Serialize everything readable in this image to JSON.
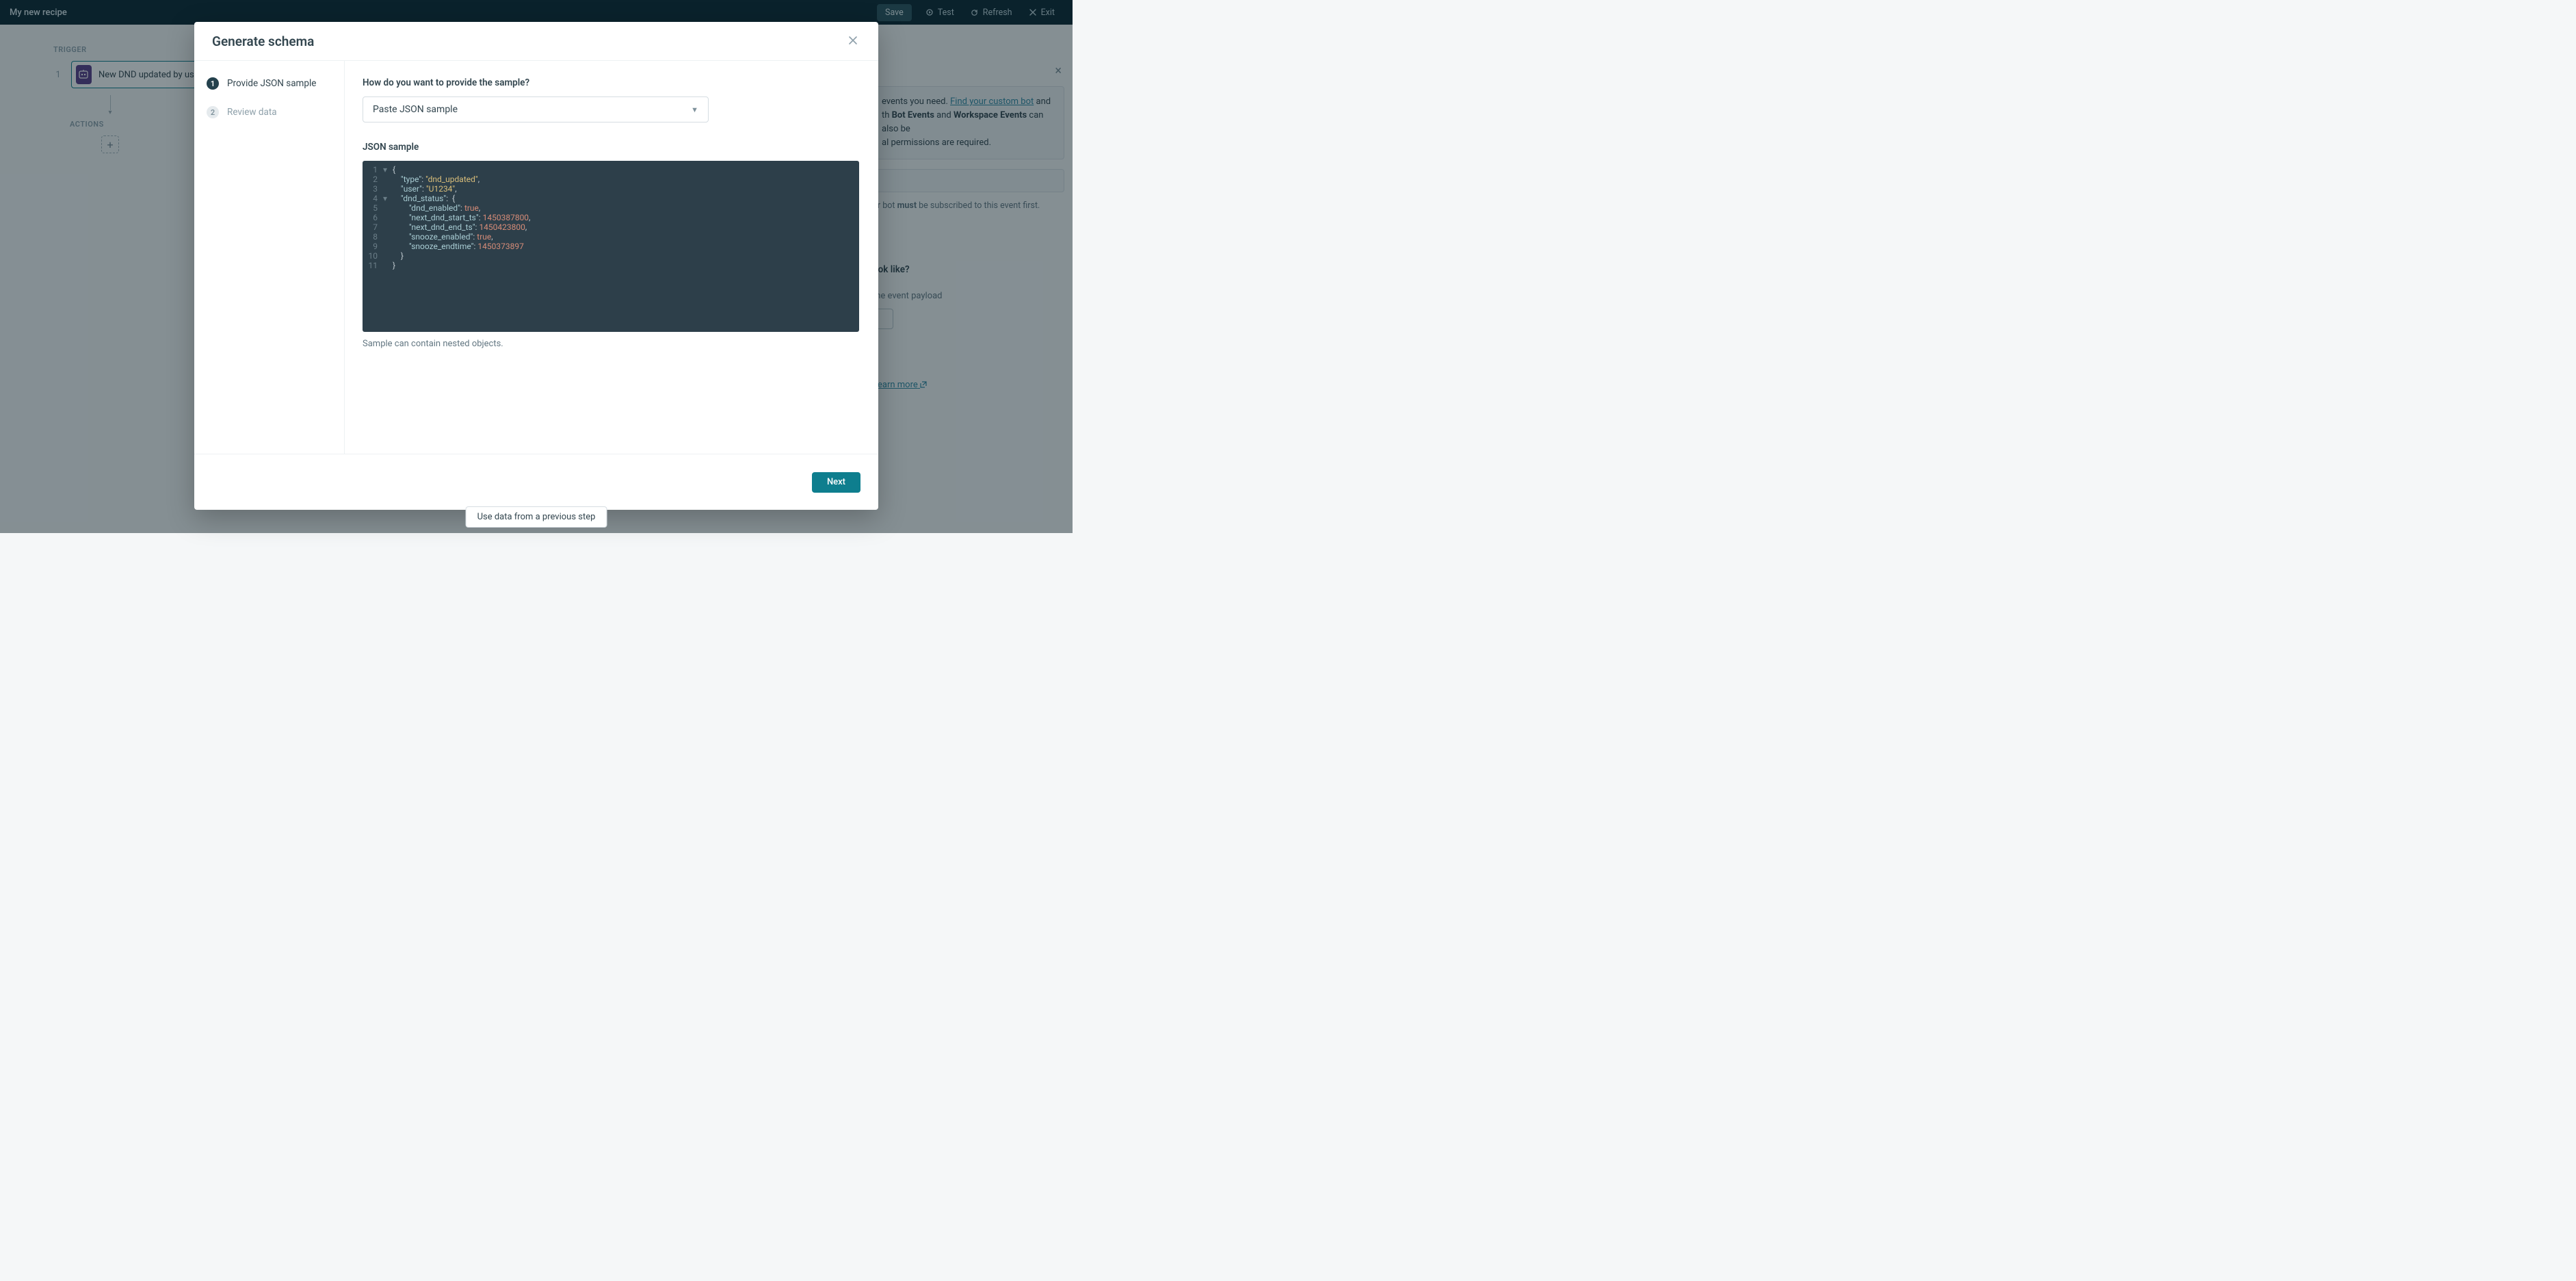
{
  "topbar": {
    "title": "My new recipe",
    "save": "Save",
    "test": "Test",
    "refresh": "Refresh",
    "exit": "Exit"
  },
  "canvas": {
    "trigger_label": "TRIGGER",
    "step_number": "1",
    "trigger_title": "New DND updated by user event b",
    "actions_label": "ACTIONS"
  },
  "right_peek": {
    "hint_pre": "events you need. ",
    "find_bot_link": "Find your custom bot",
    "hint_post1": " and",
    "hint_line2a": "th ",
    "bold_bot_events": "Bot Events",
    "and_word": " and ",
    "bold_workspace_events": "Workspace Events",
    "hint_line2b": " can also be",
    "hint_line3": "al permissions are required.",
    "subscribed_pre": "ur bot ",
    "must_word": "must",
    "subscribed_post": " be subscribed to this event first.",
    "look_like": "ook like?",
    "payload": "the event payload",
    "learn_more": "Learn more"
  },
  "modal": {
    "title": "Generate schema",
    "steps": {
      "s1_num": "1",
      "s1_label": "Provide JSON sample",
      "s2_num": "2",
      "s2_label": "Review data"
    },
    "question": "How do you want to provide the sample?",
    "select_value": "Paste JSON sample",
    "json_sample_label": "JSON sample",
    "hint": "Sample can contain nested objects.",
    "next": "Next",
    "code": {
      "line1": "{",
      "type_k": "\"type\"",
      "type_v": "\"dnd_updated\"",
      "user_k": "\"user\"",
      "user_v": "\"U1234\"",
      "dnd_status_k": "\"dnd_status\"",
      "dnd_enabled_k": "\"dnd_enabled\"",
      "dnd_enabled_v": "true",
      "next_start_k": "\"next_dnd_start_ts\"",
      "next_start_v": "1450387800",
      "next_end_k": "\"next_dnd_end_ts\"",
      "next_end_v": "1450423800",
      "snooze_en_k": "\"snooze_enabled\"",
      "snooze_en_v": "true",
      "snooze_end_k": "\"snooze_endtime\"",
      "snooze_end_v": "1450373897"
    }
  },
  "bottom_pill": "Use data from a previous step"
}
